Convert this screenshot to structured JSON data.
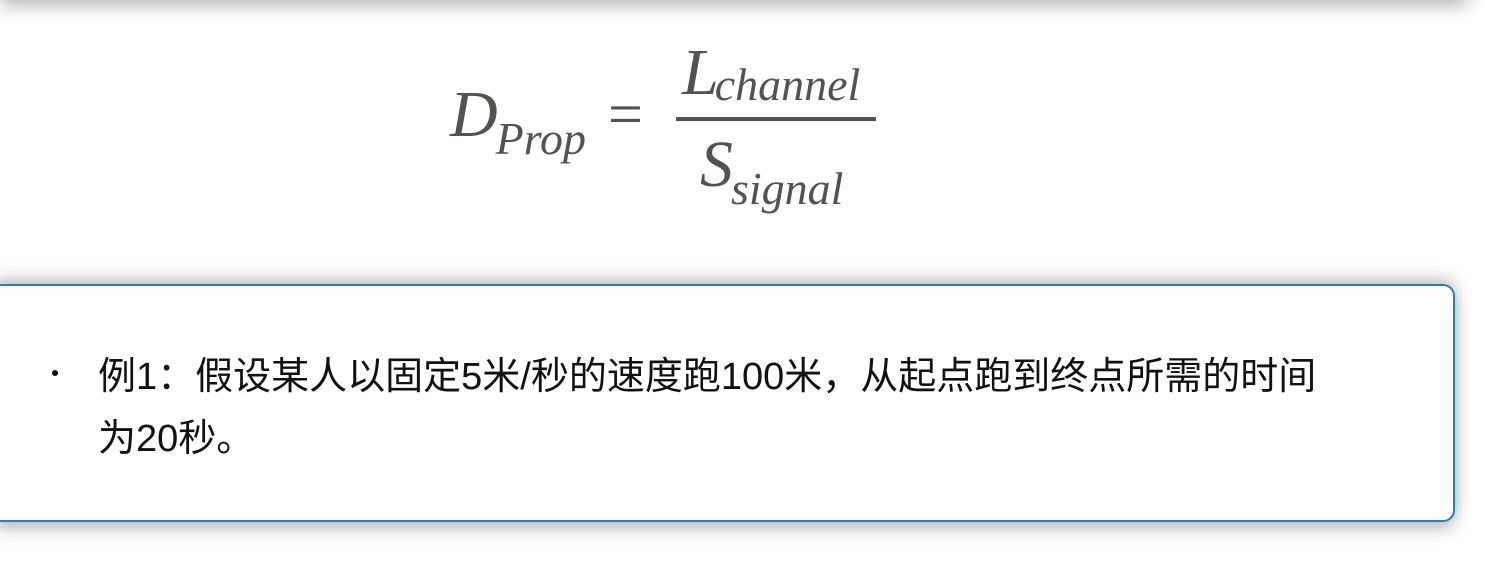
{
  "formula": {
    "lhs_main": "D",
    "lhs_sub": "Prop",
    "equals": "=",
    "numerator_main": "L",
    "numerator_sub": "channel",
    "denominator_main": "S",
    "denominator_sub": "signal",
    "color": "#55524e"
  },
  "callout": {
    "border_color": "#2a7fb8",
    "bullet_text": "例1：假设某人以固定5米/秒的速度跑100米，从起点跑到终点所需的时间为20秒。"
  }
}
